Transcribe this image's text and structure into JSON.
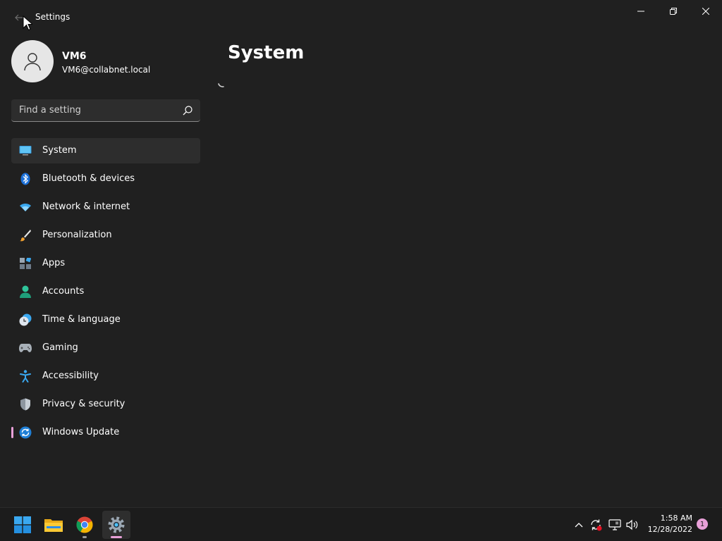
{
  "window": {
    "title": "Settings"
  },
  "profile": {
    "name": "VM6",
    "email": "VM6@collabnet.local"
  },
  "search": {
    "placeholder": "Find a setting",
    "value": ""
  },
  "nav": {
    "items": [
      {
        "label": "System",
        "icon": "monitor-icon",
        "selected": true
      },
      {
        "label": "Bluetooth & devices",
        "icon": "bluetooth-icon"
      },
      {
        "label": "Network & internet",
        "icon": "wifi-icon"
      },
      {
        "label": "Personalization",
        "icon": "brush-icon"
      },
      {
        "label": "Apps",
        "icon": "apps-icon"
      },
      {
        "label": "Accounts",
        "icon": "person-icon"
      },
      {
        "label": "Time & language",
        "icon": "clock-globe-icon"
      },
      {
        "label": "Gaming",
        "icon": "gamepad-icon"
      },
      {
        "label": "Accessibility",
        "icon": "accessibility-icon"
      },
      {
        "label": "Privacy & security",
        "icon": "shield-icon"
      },
      {
        "label": "Windows Update",
        "icon": "sync-icon",
        "indicator": true
      }
    ]
  },
  "main": {
    "title": "System"
  },
  "taskbar": {
    "apps": [
      "windows-start-icon",
      "file-explorer-icon",
      "chrome-icon",
      "settings-icon"
    ],
    "clock_time": "1:58 AM",
    "clock_date": "12/28/2022",
    "notification_count": "1"
  },
  "colors": {
    "background": "#202020",
    "selected": "#2d2d2d",
    "accent_pink": "#e8a0d8",
    "accent_blue": "#4cc2ff"
  }
}
